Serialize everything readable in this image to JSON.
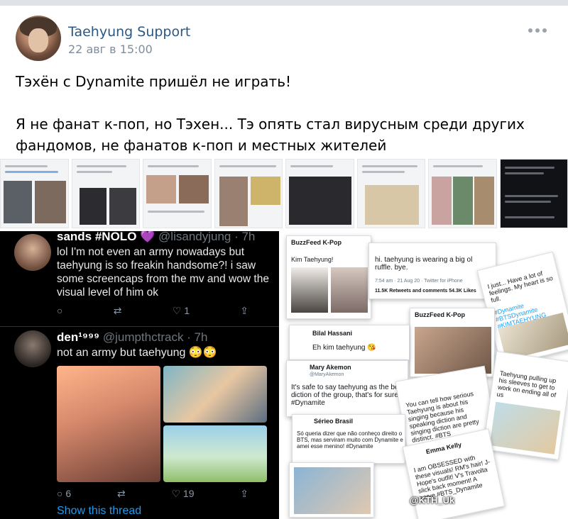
{
  "post": {
    "author": "Taehyung Support",
    "date": "22 авг в 15:00",
    "text_lines": [
      "Тэхён с Dynamite пришёл не играть!",
      "Я не фанат к-поп, но Тэхен... Тэ опять стал вирусным среди других фандомов, не фанатов к-поп и местных жителей"
    ]
  },
  "tweets": [
    {
      "name": "sands #NOLO 💜",
      "handle": "@lisandyjung · 7h",
      "text": "lol I'm not even an army nowadays but taehyung is so freakin handsome?! i saw some screencaps from the mv and wow the visual level of him ok",
      "replies": "",
      "retweets": "",
      "likes": "1"
    },
    {
      "name": "den¹⁹⁹⁹",
      "handle": "@jumpthctrack · 7h",
      "text": "not an army but taehyung 😳😳",
      "replies": "6",
      "retweets": "",
      "likes": "19",
      "show_thread": "Show this thread"
    }
  ],
  "right_cards": {
    "buzzfeed_name": "BuzzFeed K-Pop",
    "buzzfeed_text": "Kim Taehyung!",
    "ruffle_text": "hi. taehyung is wearing a big ol ruffle. bye.",
    "ruffle_meta": "7:54 am · 21 Aug 20 · Twitter for iPhone",
    "ruffle_stats": "11.5K Retweets and comments   54.3K Likes",
    "feelings_text": "I just... Have a lot of feelings. My heart is so full.",
    "feelings_tags": "#Dynamite #BTSDynamite #KIMTAEHYUNG",
    "bilal_name": "Bilal Hassani",
    "bilal_text": "Eh kim taehyung 😘",
    "mary_name": "Mary Akemon",
    "mary_handle": "@MaryAkemon",
    "mary_text": "It's safe to say taehyung as the best diction of the group, that's for sure #Dynamite",
    "serious_text": "You can tell how serious Taehyung is about his singing because his speaking diction and singing diction are pretty distinct. #BTS",
    "sleeves_text": "Taehyung pulling up his sleeves to get to work on ending all of us",
    "brasil_name": "Sérieo Brasil",
    "brasil_text": "Só queria dizer que não conheço direito o BTS, mas serviram muito com Dynamite e amei esse menino! #Dynamite",
    "emma_name": "Emma Kelly",
    "emma_text": "I am OBSESSED with these visuals! RM's hair! J-Hope's outfit! V's Travolta slick back moment! A serve #BTS_Dynamite",
    "watermark": "@KTH_Uk"
  }
}
